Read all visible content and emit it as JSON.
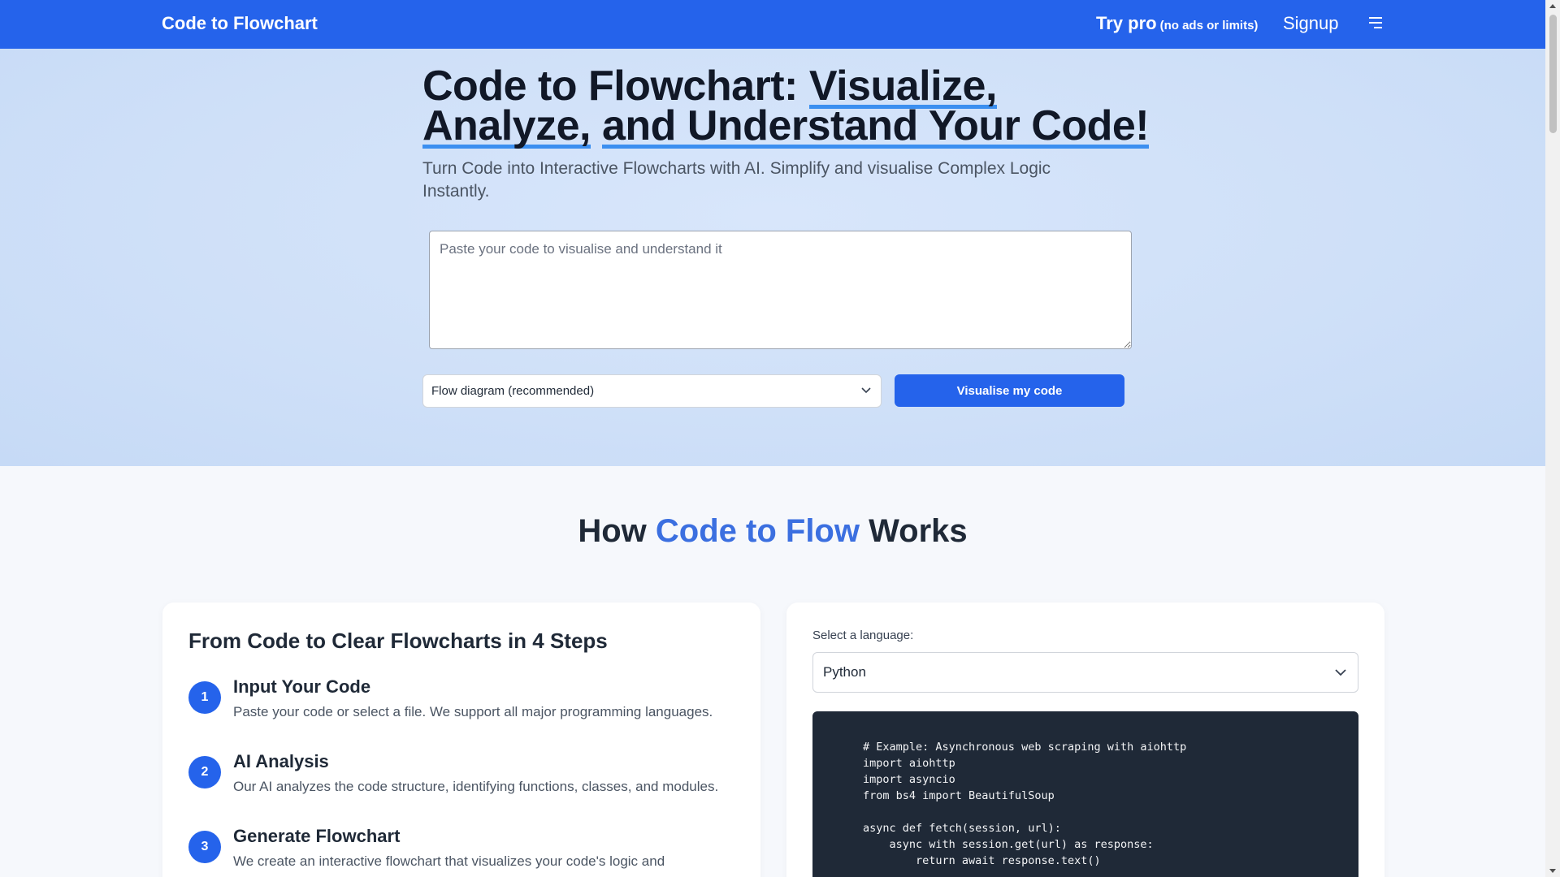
{
  "nav": {
    "brand": "Code to Flowchart",
    "try_pro": "Try pro",
    "try_pro_sub": "(no ads or limits)",
    "signup": "Signup",
    "menu_icon": "menu-icon"
  },
  "hero": {
    "title_part1": "Code to Flowchart: ",
    "title_hl1": "Visualize,",
    "title_hl2": "Analyze,",
    "title_space": " ",
    "title_hl3": "and Understand Your Code!",
    "subtitle": "Turn Code into Interactive Flowcharts with AI. Simplify and visualise Complex Logic Instantly.",
    "code_placeholder": "Paste your code to visualise and understand it",
    "diagram_type": "Flow diagram (recommended)",
    "visualise_button": "Visualise my code"
  },
  "how": {
    "title_pre": "How ",
    "title_accent": "Code to Flow",
    "title_post": " Works",
    "steps_title": "From Code to Clear Flowcharts in 4 Steps",
    "steps": [
      {
        "num": "1",
        "title": "Input Your Code",
        "desc": "Paste your code or select a file. We support all major programming languages."
      },
      {
        "num": "2",
        "title": "AI Analysis",
        "desc": "Our AI analyzes the code structure, identifying functions, classes, and modules."
      },
      {
        "num": "3",
        "title": "Generate Flowchart",
        "desc": "We create an interactive flowchart that visualizes your code's logic and"
      }
    ],
    "language_label": "Select a language:",
    "language_value": "Python",
    "example_code": "# Example: Asynchronous web scraping with aiohttp\nimport aiohttp\nimport asyncio\nfrom bs4 import BeautifulSoup\n\nasync def fetch(session, url):\n    async with session.get(url) as response:\n        return await response.text()"
  },
  "colors": {
    "primary": "#2563eb",
    "accent_text": "#3b6fe0",
    "code_bg": "#1f2937",
    "highlight_underline": "#3b8ff0"
  }
}
